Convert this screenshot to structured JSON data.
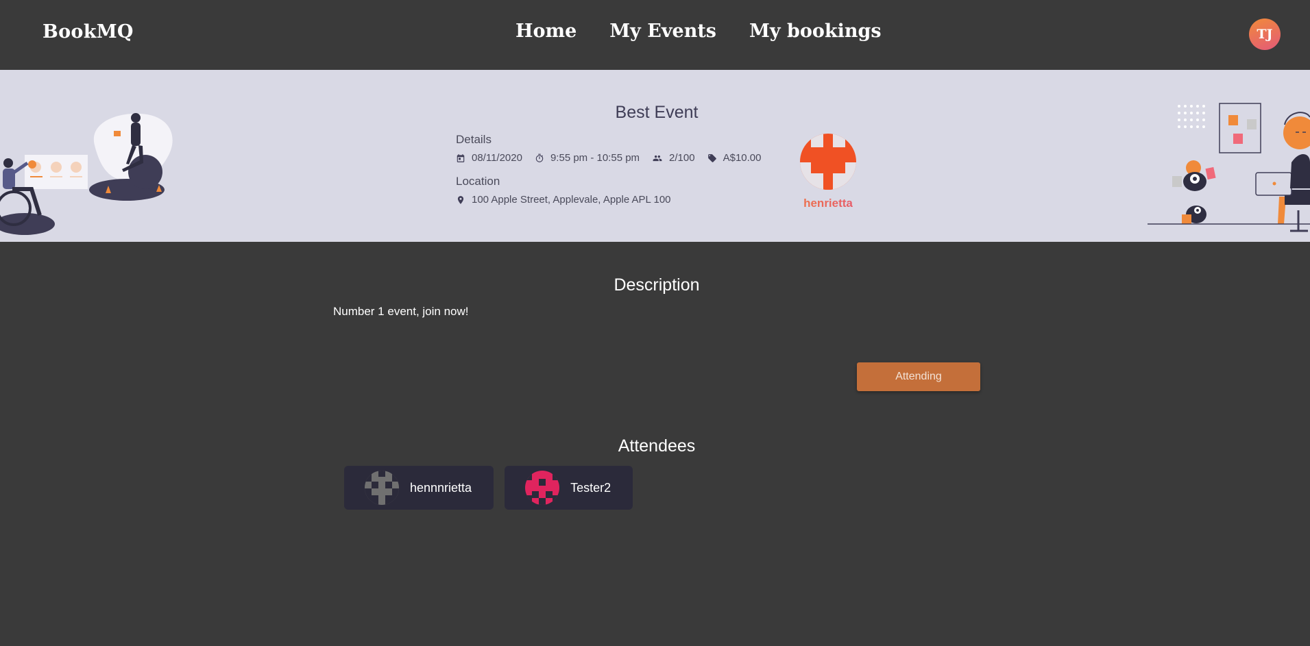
{
  "navbar": {
    "brand": "BookMQ",
    "links": [
      "Home",
      "My Events",
      "My bookings"
    ],
    "user_initials": "TJ"
  },
  "event": {
    "title": "Best Event",
    "details_label": "Details",
    "date": "08/11/2020",
    "time": "9:55 pm - 10:55 pm",
    "capacity": "2/100",
    "price": "A$10.00",
    "location_label": "Location",
    "address": "100 Apple Street, Applevale, Apple APL 100",
    "host_name": "henrietta"
  },
  "description": {
    "title": "Description",
    "text": "Number 1 event, join now!"
  },
  "attend_button": {
    "label": "Attending"
  },
  "attendees": {
    "title": "Attendees",
    "list": [
      {
        "name": "hennnrietta",
        "avatar_color": "#707070"
      },
      {
        "name": "Tester2",
        "avatar_color": "#e0245e"
      }
    ]
  },
  "icons": {
    "date": "calendar-icon",
    "time": "stopwatch-icon",
    "capacity": "people-icon",
    "price": "price-tag-icon",
    "location": "map-pin-icon"
  },
  "colors": {
    "background": "#3a3a3a",
    "banner": "#d9d9e5",
    "accent": "#c46f3a",
    "host_avatar": "#f05124",
    "card": "#2b2a3a"
  }
}
